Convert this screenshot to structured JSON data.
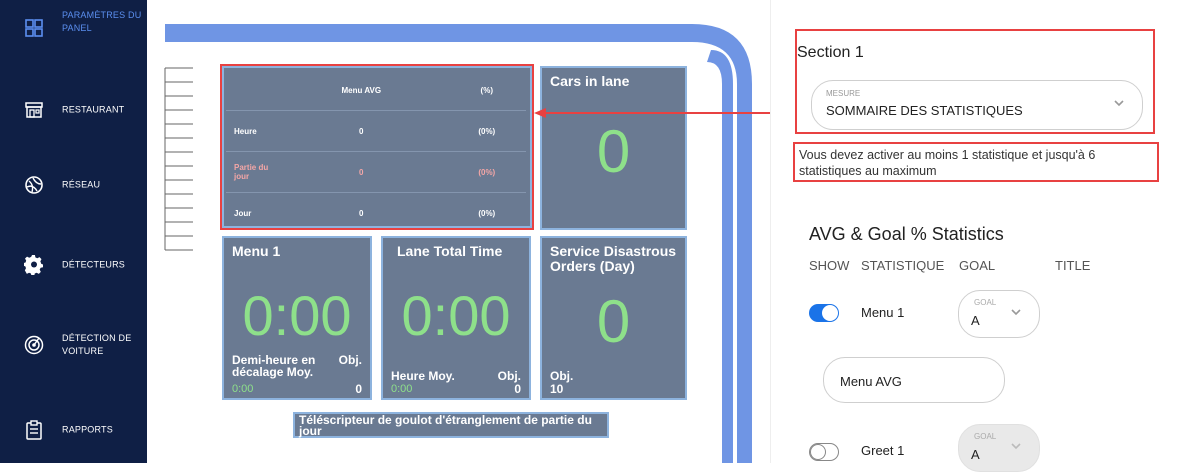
{
  "sidebar": {
    "items": [
      {
        "label": "PARAMÈTRES DU PANEL",
        "icon": "grid-icon",
        "active": true
      },
      {
        "label": "RESTAURANT",
        "icon": "store-icon",
        "active": false
      },
      {
        "label": "RÉSEAU",
        "icon": "network-icon",
        "active": false
      },
      {
        "label": "DÉTECTEURS",
        "icon": "gear-icon",
        "active": false
      },
      {
        "label": "DÉTECTION DE VOITURE",
        "icon": "target-icon",
        "active": false
      },
      {
        "label": "RAPPORTS",
        "icon": "clipboard-icon",
        "active": false
      }
    ]
  },
  "canvas": {
    "summary": {
      "col_menu": "Menu AVG",
      "col_pct": "(%)",
      "rows": [
        {
          "label": "Heure",
          "value": "0",
          "pct": "(0%)"
        },
        {
          "label": "Partie du jour",
          "value": "0",
          "pct": "(0%)"
        },
        {
          "label": "Jour",
          "value": "0",
          "pct": "(0%)"
        }
      ]
    },
    "cars_in_lane": {
      "title": "Cars in lane",
      "value": "0"
    },
    "menu1": {
      "title": "Menu 1",
      "value": "0:00",
      "sub_label": "Demi-heure en décalage Moy.",
      "sub_value": "0:00",
      "obj_label": "Obj.",
      "obj_value": "0"
    },
    "lane_total": {
      "title": "Lane Total Time",
      "value": "0:00",
      "sub_label": "Heure Moy.",
      "sub_value": "0:00",
      "obj_label": "Obj.",
      "obj_value": "0"
    },
    "service": {
      "title": "Service Disastrous Orders (Day)",
      "value": "0",
      "obj_label": "Obj.",
      "obj_value": "10"
    },
    "ticker": "Téléscripteur de goulot d'étranglement de partie du jour"
  },
  "panel": {
    "section_title": "Section 1",
    "measure": {
      "label": "MESURE",
      "value": "SOMMAIRE DES STATISTIQUES"
    },
    "notice": "Vous devez activer au moins 1 statistique et jusqu'à 6 statistiques au maximum",
    "stats_title": "AVG & Goal % Statistics",
    "columns": {
      "show": "SHOW",
      "stat": "STATISTIQUE",
      "goal": "GOAL",
      "title": "TITLE"
    },
    "rows": [
      {
        "name": "Menu 1",
        "enabled": true,
        "goal_label": "GOAL",
        "goal_value": "A",
        "title_value": "Menu AVG"
      },
      {
        "name": "Greet 1",
        "enabled": false,
        "goal_label": "GOAL",
        "goal_value": "A"
      }
    ]
  },
  "colors": {
    "sidebar": "#0f1f45",
    "accent": "#1a73e8",
    "tile": "#6a7a92",
    "digits": "#8ee08a",
    "highlight": "#e84141",
    "lane": "#6f95e4"
  }
}
